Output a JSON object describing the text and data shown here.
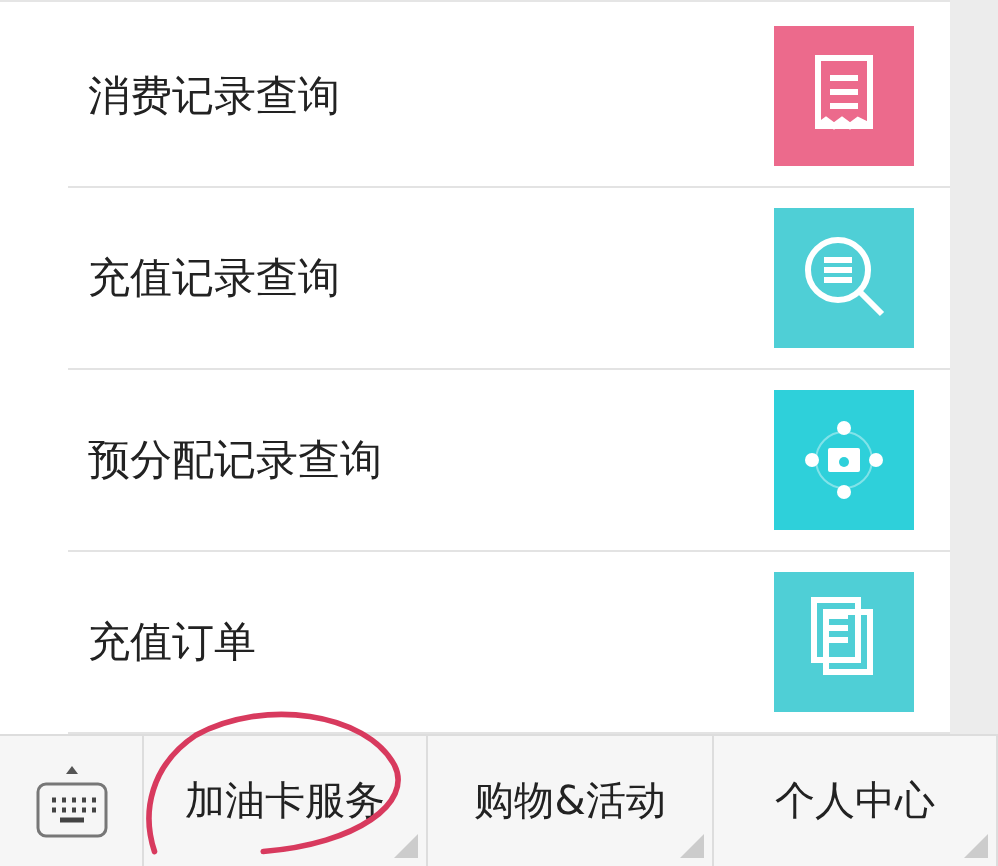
{
  "menu_items": [
    {
      "label": "消费记录查询",
      "kind": "receipt",
      "color": "#ec6a8c"
    },
    {
      "label": "充值记录查询",
      "kind": "search",
      "color": "#4fcfd6"
    },
    {
      "label": "预分配记录查询",
      "kind": "network",
      "color": "#2ed0da"
    },
    {
      "label": "充值订单",
      "kind": "document",
      "color": "#4fcfd6"
    }
  ],
  "bottom_menu": [
    {
      "label": "加油卡服务",
      "circled": true
    },
    {
      "label": "购物&活动",
      "circled": false
    },
    {
      "label": "个人中心",
      "circled": false
    }
  ]
}
